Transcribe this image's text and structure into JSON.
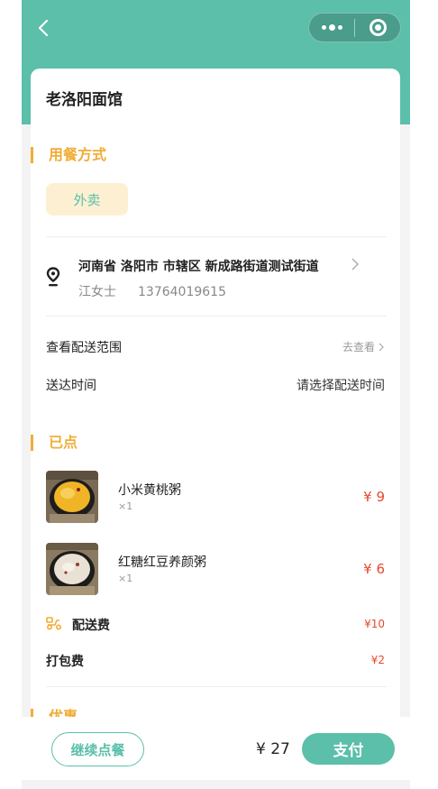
{
  "colors": {
    "accent": "#5bbfaa",
    "section": "#f0ad35",
    "price": "#e5482f"
  },
  "nav": {
    "back_icon": "chevron-left-icon",
    "more_icon": "more-dots-icon",
    "close_icon": "target-icon"
  },
  "shop": {
    "name": "老洛阳面馆"
  },
  "dining": {
    "title": "用餐方式",
    "mode": "外卖"
  },
  "address": {
    "text": "河南省 洛阳市 市辖区 新成路街道测试街道",
    "contact_name": "江女士",
    "phone": "13764019615"
  },
  "delivery_range": {
    "label": "查看配送范围",
    "link": "去查看"
  },
  "delivery_time": {
    "label": "送达时间",
    "value": "请选择配送时间"
  },
  "ordered": {
    "title": "已点",
    "items": [
      {
        "name": "小米黄桃粥",
        "qty": "×1",
        "price": "¥ 9"
      },
      {
        "name": "红糖红豆养颜粥",
        "qty": "×1",
        "price": "¥ 6"
      }
    ]
  },
  "fees": {
    "delivery_label": "配送费",
    "delivery_price": "¥10",
    "packing_label": "打包费",
    "packing_price": "¥2"
  },
  "discount": {
    "title": "优惠"
  },
  "footer": {
    "continue_label": "继续点餐",
    "total": "¥ 27",
    "pay_label": "支付"
  }
}
